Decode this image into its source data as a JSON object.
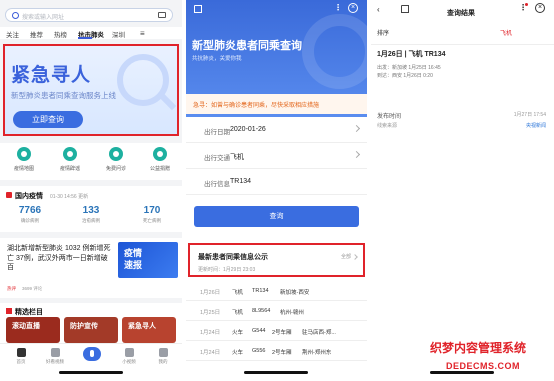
{
  "screen1": {
    "search_placeholder": "搜索或输入网址",
    "tabs": [
      "关注",
      "推荐",
      "热榜",
      "抗击肺炎",
      "深圳"
    ],
    "banner": {
      "title": "紧急寻人",
      "subtitle": "新型肺炎患者同乘查询服务上线",
      "button": "立即查询"
    },
    "icons": [
      "疫情地图",
      "疫情辟谣",
      "免费问诊",
      "公益捐赠"
    ],
    "stats_section": {
      "title": "国内疫情",
      "update": "01-30 14:56 更新",
      "link": "查看更多"
    },
    "stats": [
      {
        "num": "7766",
        "label": "确诊病例"
      },
      {
        "num": "133",
        "label": "治愈病例"
      },
      {
        "num": "170",
        "label": "死亡病例"
      }
    ],
    "news": {
      "title": "湖北新增新型肺炎 1032 例新增死亡 37例，武汉外两市一日新增破百",
      "source": "热评",
      "views": "3699 评论",
      "image_text": "疫情\n速报"
    },
    "picks": {
      "title": "精选栏目",
      "items": [
        "滚动直播",
        "防护宣传",
        "紧急寻人"
      ]
    },
    "nav": [
      "首页",
      "好看视频",
      "",
      "小视频",
      "我的"
    ]
  },
  "screen2": {
    "title": "新型肺炎患者同乘查询",
    "subtitle": "共抗肺炎，关爱你我",
    "warning": "急寻：如曾与确诊患者同乘，尽快采取相应措施",
    "form": [
      {
        "key": "出行日期",
        "value": "2020-01-26"
      },
      {
        "key": "出行交通",
        "value": "飞机"
      },
      {
        "key": "出行信息",
        "value": "TR134"
      }
    ],
    "button": "查询",
    "publish": {
      "title": "最新患者同乘信息公示",
      "updated": "更新时间：1月29日 23:03",
      "more": "全部"
    },
    "records": [
      [
        "1月26日",
        "飞机",
        "TR134",
        "新加坡-西安"
      ],
      [
        "1月25日",
        "飞机",
        "8L9564",
        "杭州-赣州"
      ],
      [
        "1月24日",
        "火车",
        "G544",
        "2号车厢",
        "驻马店西-郑..."
      ],
      [
        "1月24日",
        "火车",
        "G556",
        "2号车厢",
        "荆州-郑州东"
      ]
    ]
  },
  "screen3": {
    "title": "查询结果",
    "sort": "排序",
    "filter": "飞机",
    "result": {
      "head": "1月26日 | 飞机 TR134",
      "line1": "出发：新加坡 1月25日 16:45",
      "line2": "到达：西安 1月26日 0:20"
    },
    "publish_time_label": "发布时间",
    "publish_time": "1月27日 17:54",
    "source_label": "线索来源",
    "source": "央视新闻"
  },
  "watermark": {
    "cn": "织梦内容管理系统",
    "en": "DEDECMS.COM"
  }
}
